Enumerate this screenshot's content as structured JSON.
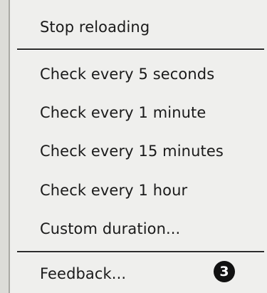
{
  "menu": {
    "items": [
      {
        "label": "Stop reloading"
      },
      {
        "label": "Check every 5 seconds"
      },
      {
        "label": "Check every 1 minute"
      },
      {
        "label": "Check every 15 minutes"
      },
      {
        "label": "Check every 1 hour"
      },
      {
        "label": "Custom duration..."
      },
      {
        "label": "Feedback..."
      }
    ]
  },
  "callout": {
    "number": "3"
  }
}
